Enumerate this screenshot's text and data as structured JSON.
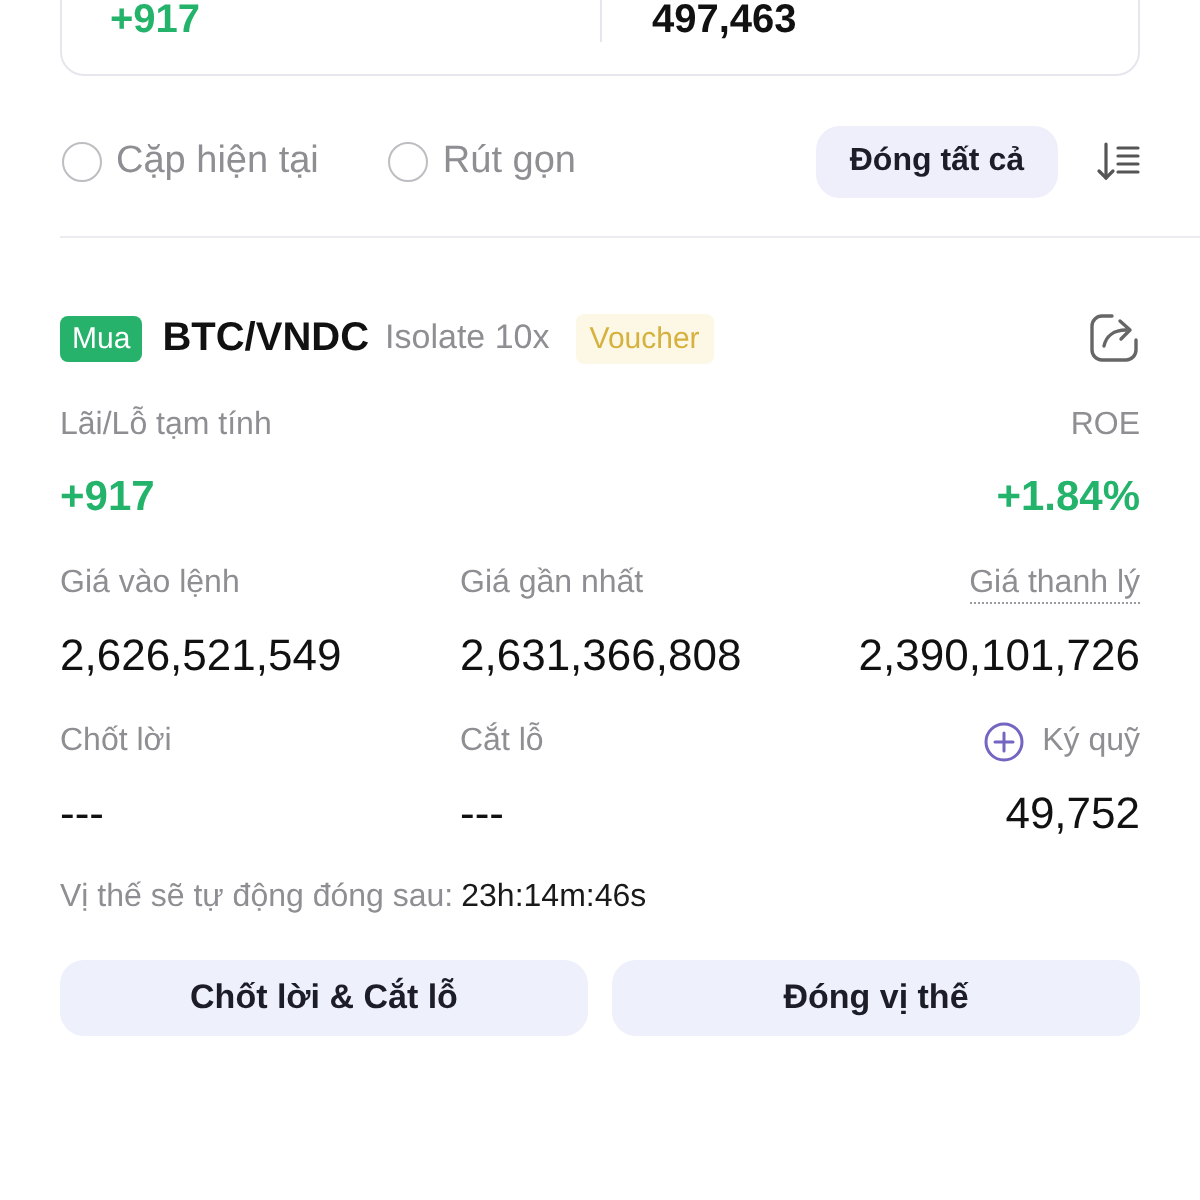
{
  "summary_card": {
    "pnl": "+917",
    "value": "497,463"
  },
  "filters": [
    {
      "label": "Cặp hiện tại",
      "checked": false
    },
    {
      "label": "Rút gọn",
      "checked": false
    }
  ],
  "close_all_button": "Đóng tất cả",
  "position": {
    "side": "Mua",
    "pair": "BTC/VNDC",
    "mode": "Isolate 10x",
    "tag": "Voucher",
    "pnl_label": "Lãi/Lỗ tạm tính",
    "pnl": "+917",
    "roe_label": "ROE",
    "roe": "+1.84%",
    "fields": [
      {
        "kind": "plain",
        "label": "Giá vào lệnh",
        "value": "2,626,521,549"
      },
      {
        "kind": "plain",
        "label": "Giá gần nhất",
        "value": "2,631,366,808"
      },
      {
        "kind": "hint",
        "label": "Giá thanh lý",
        "value": "2,390,101,726"
      },
      {
        "kind": "plain",
        "label": "Chốt lời",
        "value": "---"
      },
      {
        "kind": "plain",
        "label": "Cắt lỗ",
        "value": "---"
      },
      {
        "kind": "add",
        "label": "Ký quỹ",
        "value": "49,752"
      }
    ],
    "auto_close": {
      "label": "Vị thế sẽ tự động đóng sau:",
      "time": "23h:14m:46s"
    },
    "buttons": [
      "Chốt lời & Cắt lỗ",
      "Đóng vị thế"
    ]
  }
}
